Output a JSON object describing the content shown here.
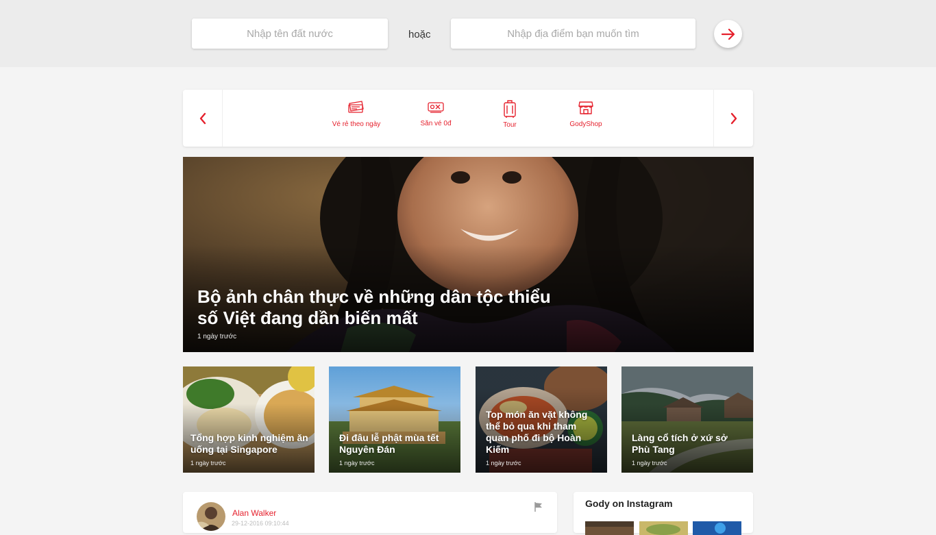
{
  "search": {
    "country_placeholder": "Nhập tên đất nước",
    "or_text": "hoặc",
    "place_placeholder": "Nhập địa điểm bạn muốn tìm"
  },
  "nav": {
    "items": [
      {
        "label": "Vé rẻ theo ngày",
        "icon": "ticket-icon"
      },
      {
        "label": "Săn vé 0đ",
        "icon": "free-ticket-icon"
      },
      {
        "label": "Tour",
        "icon": "luggage-icon"
      },
      {
        "label": "GodyShop",
        "icon": "shop-icon"
      }
    ]
  },
  "hero": {
    "title": "Bộ ảnh chân thực về những dân tộc thiểu số Việt đang dần biến mất",
    "time": "1 ngày trước"
  },
  "articles": [
    {
      "title": "Tổng hợp kinh nghiệm ăn uống tại Singapore",
      "time": "1 ngày trước"
    },
    {
      "title": "Đi đâu lễ phật mùa tết Nguyên Đán",
      "time": "1 ngày trước"
    },
    {
      "title": "Top món ăn vặt không thể bỏ qua khi tham quan phố đi bộ Hoàn Kiếm",
      "time": "1 ngày trước"
    },
    {
      "title": "Làng cổ tích ở xứ sở Phù Tang",
      "time": "1 ngày trước"
    }
  ],
  "post": {
    "author": "Alan Walker",
    "date": "29-12-2016 09:10:44"
  },
  "instagram": {
    "title": "Gody on Instagram"
  },
  "colors": {
    "accent": "#e5202c",
    "background": "#f4f4f4"
  }
}
